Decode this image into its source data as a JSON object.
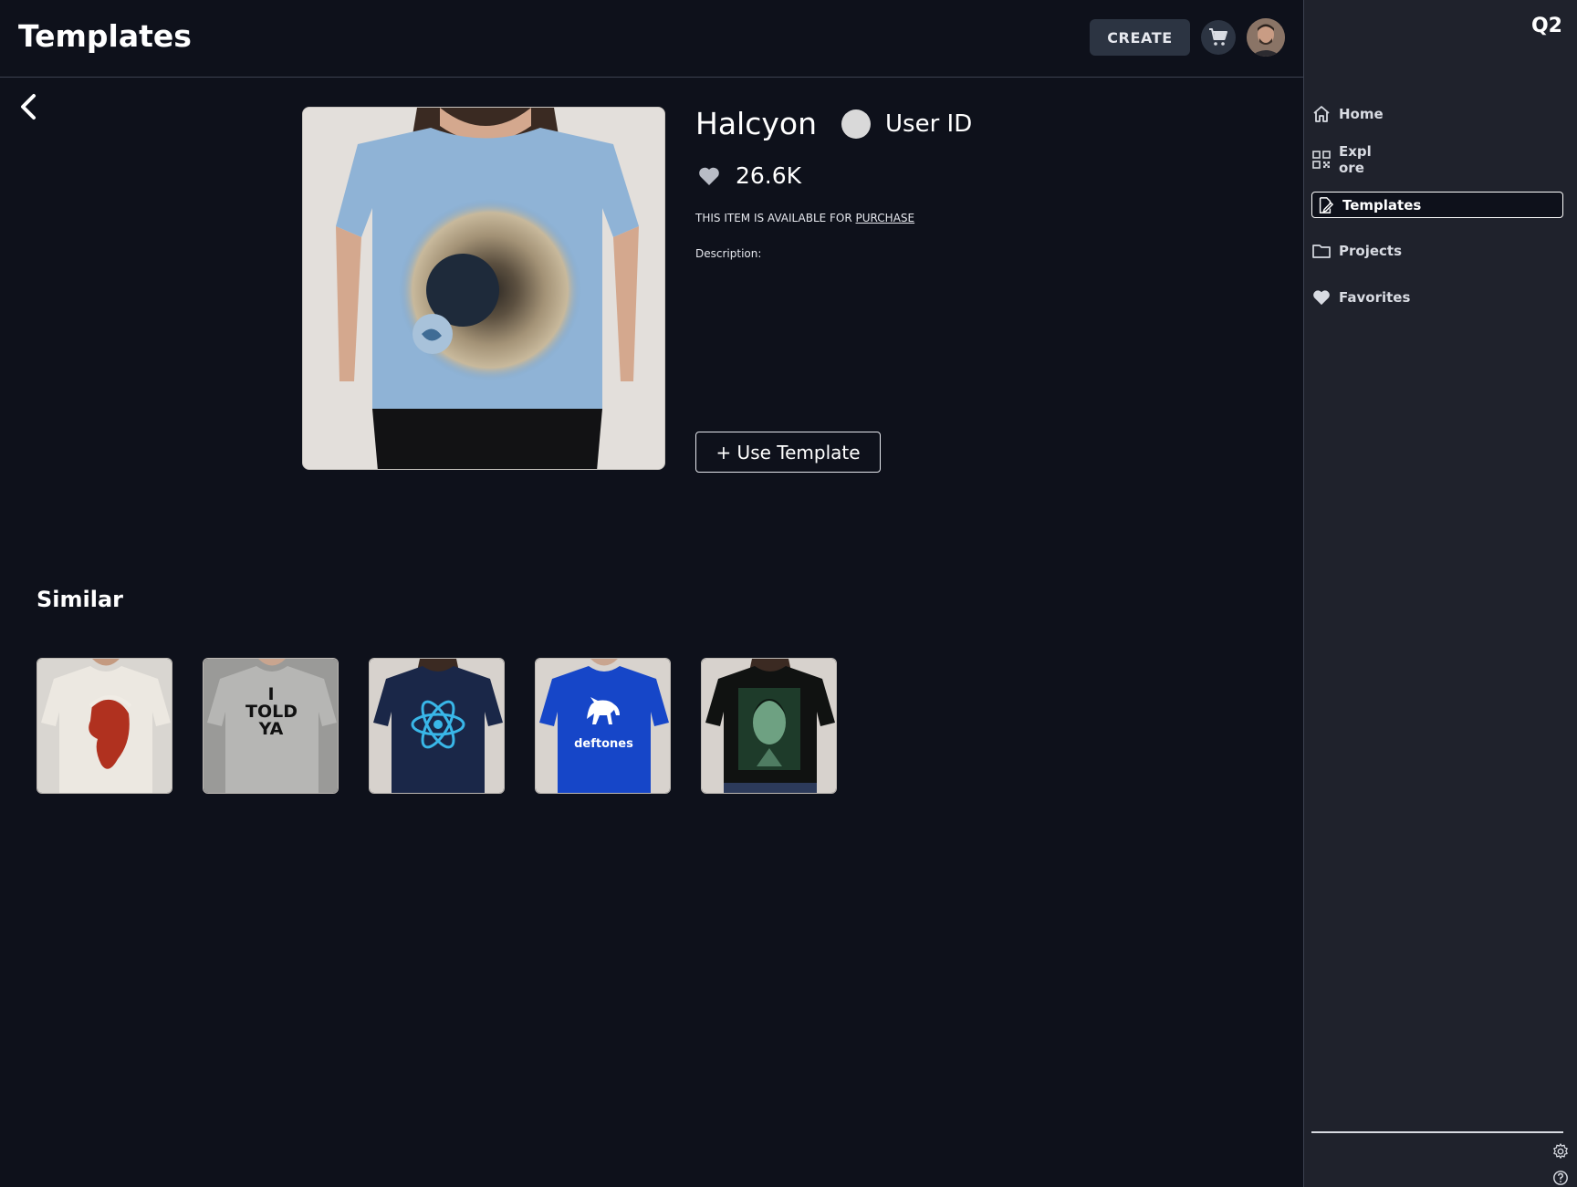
{
  "header": {
    "title": "Templates",
    "create_label": "CREATE",
    "cart_icon": "cart-icon",
    "avatar_icon": "user-avatar"
  },
  "product": {
    "name": "Halcyon",
    "owner": "User ID",
    "likes": "26.6K",
    "availability_text": "THIS ITEM IS AVAILABLE FOR ",
    "availability_link": "PURCHASE",
    "description_label": "Description:",
    "use_template_label": "+ Use Template",
    "image_icon": "tshirt-eye-print"
  },
  "similar": {
    "title": "Similar",
    "items": [
      {
        "name": "white-tshirt-red-head",
        "text": ""
      },
      {
        "name": "grey-tshirt-i-told-ya",
        "text": "I TOLD YA"
      },
      {
        "name": "navy-tshirt-atom",
        "text": ""
      },
      {
        "name": "blue-tshirt-deftones",
        "text": "deftones"
      },
      {
        "name": "black-tshirt-portrait",
        "text": ""
      }
    ]
  },
  "sidebar": {
    "brand": "Q2",
    "items": [
      {
        "label": "Home",
        "icon": "home-icon"
      },
      {
        "label": "Expl\nore",
        "icon": "qr-grid-icon"
      },
      {
        "label": "Templates",
        "icon": "edit-file-icon",
        "active": true
      },
      {
        "label": "Projects",
        "icon": "folder-icon"
      },
      {
        "label": "Favorites",
        "icon": "heart-icon"
      }
    ],
    "settings_icon": "gear-icon",
    "help_icon": "help-icon"
  },
  "colors": {
    "background": "#0e111b",
    "sidebar": "#1f222c",
    "button": "#2c3442"
  }
}
